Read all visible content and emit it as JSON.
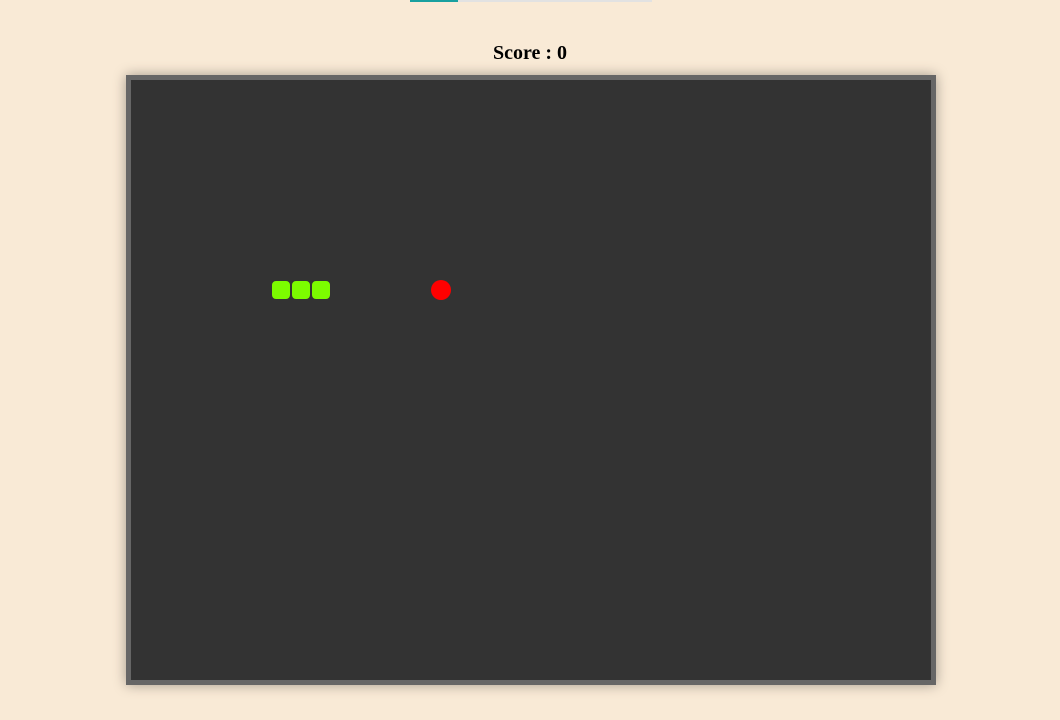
{
  "score": {
    "label": "Score : ",
    "value": "0"
  },
  "progress": {
    "fraction": 0.2
  },
  "colors": {
    "snake": "#7cfc00",
    "food": "#ff0000",
    "board": "#333333",
    "border": "#666666",
    "page_bg": "#f9ead6"
  },
  "grid": {
    "cols": 40,
    "rows": 30
  },
  "snake": [
    {
      "col": 9,
      "row": 10
    },
    {
      "col": 8,
      "row": 10
    },
    {
      "col": 7,
      "row": 10
    }
  ],
  "food": {
    "col": 15,
    "row": 10
  }
}
